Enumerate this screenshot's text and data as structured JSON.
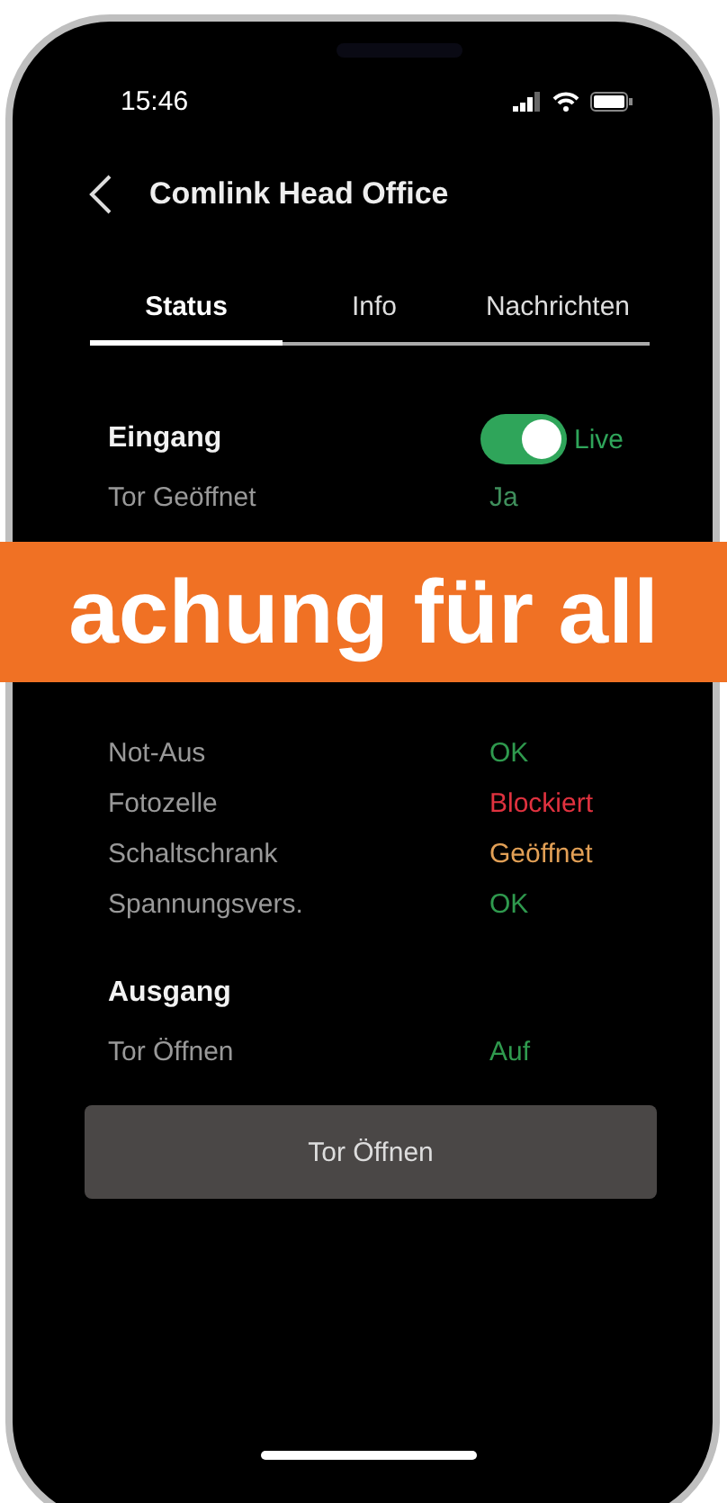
{
  "status_bar": {
    "time": "15:46"
  },
  "header": {
    "title": "Comlink Head Office"
  },
  "tabs": [
    {
      "label": "Status",
      "selected": true
    },
    {
      "label": "Info",
      "selected": false
    },
    {
      "label": "Nachrichten",
      "selected": false
    }
  ],
  "sections": [
    {
      "title": "Eingang",
      "toggle": {
        "on": true,
        "label": "Live"
      },
      "rows": [
        {
          "label": "Tor Geöffnet",
          "value": "Ja",
          "color": "#3f8f5c"
        },
        {
          "kind": "gap"
        },
        {
          "label": "Not-Aus",
          "value": "OK",
          "color": "#2f9a4e"
        },
        {
          "label": "Fotozelle",
          "value": "Blockiert",
          "color": "#e0323f"
        },
        {
          "label": "Schaltschrank",
          "value": "Geöffnet",
          "color": "#e2a056"
        },
        {
          "label": "Spannungsvers.",
          "value": "OK",
          "color": "#2f9a4e"
        }
      ]
    },
    {
      "title": "Ausgang",
      "rows": [
        {
          "label": "Tor Öffnen",
          "value": "Auf",
          "color": "#2f9a4e"
        }
      ]
    }
  ],
  "action_button": {
    "label": "Tor Öffnen"
  },
  "banner": {
    "text": "achung für all"
  }
}
